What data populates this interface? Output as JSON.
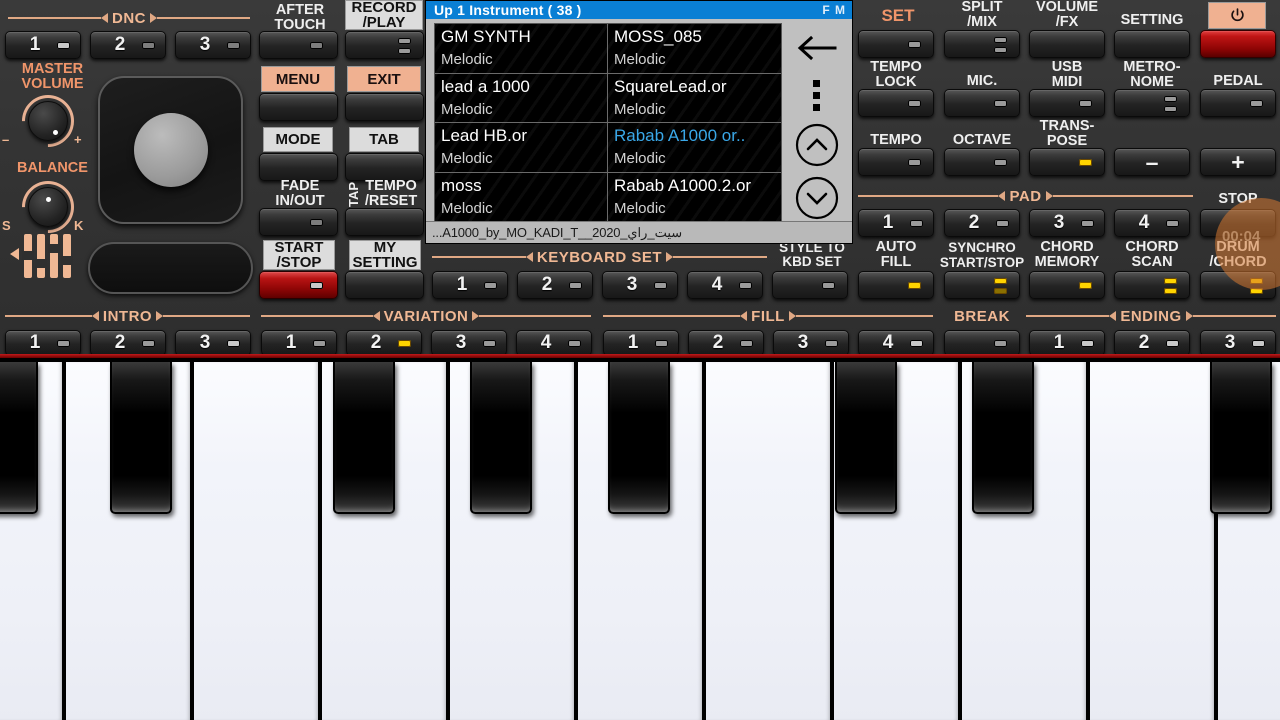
{
  "lcd": {
    "title": "Up 1 Instrument ( 38 )",
    "flag": "F M",
    "status": "...A1000_by_MO_KADI_T__2020_سيت_راي",
    "items": [
      {
        "name": "GM SYNTH",
        "type": "Melodic",
        "selected": false
      },
      {
        "name": "MOSS_085",
        "type": "Melodic",
        "selected": false
      },
      {
        "name": "lead a 1000",
        "type": "Melodic",
        "selected": false
      },
      {
        "name": "SquareLead.or",
        "type": "Melodic",
        "selected": false
      },
      {
        "name": "Lead HB.or",
        "type": "Melodic",
        "selected": false
      },
      {
        "name": "Rabab A1000 or..",
        "type": "Melodic",
        "selected": true
      },
      {
        "name": "moss",
        "type": "Melodic",
        "selected": false
      },
      {
        "name": "Rabab A1000.2.or",
        "type": "Melodic",
        "selected": false
      }
    ],
    "nav": {
      "back": "back-arrow-icon",
      "more": "more-vertical-icon",
      "up": "chevron-up-icon",
      "down": "chevron-down-icon"
    }
  },
  "left": {
    "dnc_label": "DNC",
    "dnc_buttons": [
      "1",
      "2",
      "3"
    ],
    "after_touch": "AFTER\nTOUCH",
    "after_touch_l1": "AFTER",
    "after_touch_l2": "TOUCH",
    "record_play_l1": "RECORD",
    "record_play_l2": "/PLAY",
    "master_volume_l1": "MASTER",
    "master_volume_l2": "VOLUME",
    "master_minus": "–",
    "master_plus": "+",
    "balance": "BALANCE",
    "balance_s": "S",
    "balance_k": "K",
    "menu": "MENU",
    "exit": "EXIT",
    "mode": "MODE",
    "tab": "TAB",
    "fade_l1": "FADE",
    "fade_l2": "IN/OUT",
    "tap": "TAP",
    "tempo_reset_l1": "TEMPO",
    "tempo_reset_l2": "/RESET",
    "start_stop_l1": "START",
    "start_stop_l2": "/STOP",
    "my_setting_l1": "MY",
    "my_setting_l2": "SETTING"
  },
  "center": {
    "keyboard_set_label": "KEYBOARD SET",
    "keyboard_set_buttons": [
      "1",
      "2",
      "3",
      "4"
    ],
    "style_to_kbd_l1": "STYLE TO",
    "style_to_kbd_l2": "KBD SET"
  },
  "right": {
    "set": "SET",
    "split_mix_l1": "SPLIT",
    "split_mix_l2": "/MIX",
    "volume_fx_l1": "VOLUME",
    "volume_fx_l2": "/FX",
    "setting": "SETTING",
    "power_icon": "power-icon",
    "tempo_lock_l1": "TEMPO",
    "tempo_lock_l2": "LOCK",
    "mic": "MIC.",
    "usb_midi_l1": "USB",
    "usb_midi_l2": "MIDI",
    "metronome_l1": "METRO-",
    "metronome_l2": "NOME",
    "pedal": "PEDAL",
    "tempo": "TEMPO",
    "octave": "OCTAVE",
    "transpose_l1": "TRANS-",
    "transpose_l2": "POSE",
    "minus": "–",
    "plus": "+",
    "pad_label": "PAD",
    "pad_buttons": [
      "1",
      "2",
      "3",
      "4"
    ],
    "stop": "STOP",
    "auto_fill_l1": "AUTO",
    "auto_fill_l2": "FILL",
    "synchro_l1": "SYNCHRO",
    "synchro_l2": "START/STOP",
    "chord_memory_l1": "CHORD",
    "chord_memory_l2": "MEMORY",
    "chord_scan_l1": "CHORD",
    "chord_scan_l2": "SCAN",
    "drum_chord_l1": "DRUM",
    "drum_chord_l2": "/CHORD",
    "rec_time": "00:04"
  },
  "bottom": {
    "intro_label": "INTRO",
    "intro_buttons": [
      "1",
      "2",
      "3"
    ],
    "variation_label": "VARIATION",
    "variation_buttons": [
      "1",
      "2",
      "3",
      "4"
    ],
    "fill_label": "FILL",
    "fill_buttons": [
      "1",
      "2",
      "3",
      "4"
    ],
    "break_label": "BREAK",
    "ending_label": "ENDING",
    "ending_buttons": [
      "1",
      "2",
      "3"
    ]
  },
  "colors": {
    "accent_peach": "#f0b894",
    "title_blue": "#0a7fd4",
    "selected_text": "#3aa8e8",
    "led_amber": "#ffd400",
    "red_button": "#b81414"
  }
}
